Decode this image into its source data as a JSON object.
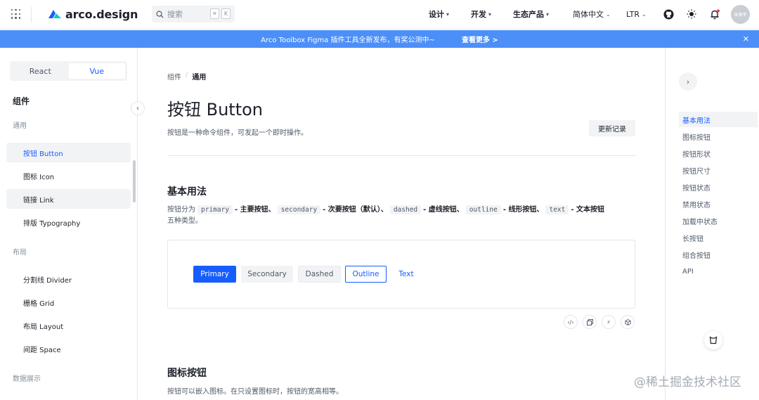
{
  "header": {
    "logo_text": "arco.design",
    "search_placeholder": "搜索",
    "search_keys": [
      "⌘",
      "K"
    ],
    "nav": [
      {
        "label": "设计"
      },
      {
        "label": "开发"
      },
      {
        "label": "生态产品"
      },
      {
        "label": "简体中文"
      },
      {
        "label": "LTR"
      }
    ],
    "avatar_text": "米黄李"
  },
  "banner": {
    "text": "Arco Toolbox Figma 插件工具全新发布，有奖公测中~",
    "link": "查看更多 >"
  },
  "sidebar": {
    "segments": [
      "React",
      "Vue"
    ],
    "active_segment": "Vue",
    "title": "组件",
    "groups": [
      {
        "label": "通用",
        "items": [
          "按钮 Button",
          "图标 Icon",
          "链接 Link",
          "排版 Typography"
        ]
      },
      {
        "label": "布局",
        "items": [
          "分割线 Divider",
          "栅格 Grid",
          "布局 Layout",
          "间距 Space"
        ]
      },
      {
        "label": "数据展示",
        "items": []
      }
    ]
  },
  "main": {
    "breadcrumb": [
      "组件",
      "/",
      "通用"
    ],
    "title": "按钮 Button",
    "description": "按钮是一种命令组件，可发起一个即时操作。",
    "changelog_label": "更新记录",
    "sections": [
      {
        "heading": "基本用法",
        "para": {
          "p1": "按钮分为",
          "c1": "primary",
          "t1": "- 主要按钮、",
          "c2": "secondary",
          "t2": "- 次要按钮（默认）、",
          "c3": "dashed",
          "t3": "- 虚线按钮、",
          "c4": "outline",
          "t4": "- 线形按钮、",
          "c5": "text",
          "t5": "- 文本按钮",
          "line2": "五种类型。"
        },
        "demo_buttons": [
          "Primary",
          "Secondary",
          "Dashed",
          "Outline",
          "Text"
        ]
      },
      {
        "heading": "图标按钮",
        "para": "按钮可以嵌入图标。在只设置图标时，按钮的宽高相等。"
      }
    ],
    "demo_tools": [
      "code-icon",
      "copy-icon",
      "codepen-icon",
      "codesandbox-icon"
    ]
  },
  "toc": {
    "items": [
      "基本用法",
      "图标按钮",
      "按钮形状",
      "按钮尺寸",
      "按钮状态",
      "禁用状态",
      "加载中状态",
      "长按钮",
      "组合按钮",
      "API"
    ],
    "active": "基本用法"
  },
  "watermark": "@稀土掘金技术社区",
  "colors": {
    "primary": "#165dff",
    "banner": "#4c8ff8",
    "fill": "#f2f3f5",
    "border": "#e5e6eb"
  }
}
